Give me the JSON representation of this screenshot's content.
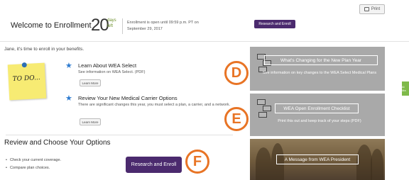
{
  "print": {
    "label": "Print"
  },
  "header": {
    "title": "Welcome to Enrollment",
    "days_count": "20",
    "days_unit_line1": "days",
    "days_unit_line2": "left",
    "enrollment_notice": "Enrollment is open until 09:59 p.m. PT on September 29, 2017",
    "research_button": "Research and Enroll"
  },
  "greeting": "Jane, it's time to enroll in your benefits.",
  "note": {
    "text": "TO DO..."
  },
  "items": [
    {
      "title": "Learn About WEA Select",
      "description": "See information on WEA Select. (PDF)",
      "button": "Learn More"
    },
    {
      "title": "Review Your New Medical Carrier Options",
      "description": "There are significant changes this year, you must select a plan, a carrier, and a network.",
      "button": "Learn More"
    }
  ],
  "review": {
    "title": "Review and Choose Your Options",
    "bullets": [
      "Check your current coverage.",
      "Compare plan choices."
    ],
    "button": "Research and Enroll"
  },
  "callouts": {
    "d": "D",
    "e": "E",
    "f": "F"
  },
  "panels": [
    {
      "title": "What's Changing for the New Plan Year",
      "description": "See information on key changes to the WEA Select Medical Plans"
    },
    {
      "title": "WEA Open Enrollment Checklist",
      "description": "Print this out and keep track of your steps (PDF)"
    },
    {
      "title": "A Message from WEA President"
    }
  ],
  "side_tab": {
    "label": "Ai Ma"
  },
  "colors": {
    "purple": "#4b2a6e",
    "orange_callout": "#e87425",
    "panel_gray": "#a9a9a9",
    "note_yellow": "#f7eb73",
    "star_blue": "#2e7bd0",
    "days_green": "#6b8f2a"
  },
  "icons": {
    "print": "printer-icon",
    "item": "star-icon",
    "checklist": "checklist-icon"
  }
}
